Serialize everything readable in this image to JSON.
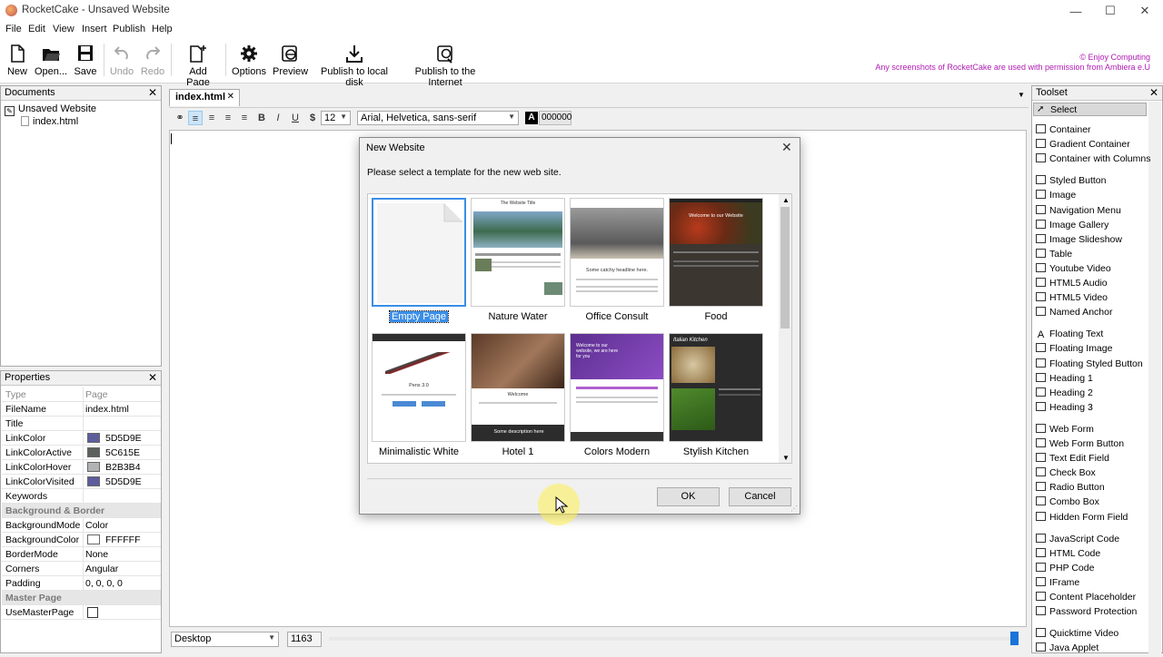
{
  "window": {
    "title": "RocketCake - Unsaved Website",
    "minimize": "—",
    "maximize": "☐",
    "close": "✕"
  },
  "menu": [
    "File",
    "Edit",
    "View",
    "Insert",
    "Publish",
    "Help"
  ],
  "toolbar": {
    "new": "New",
    "open": "Open...",
    "save": "Save",
    "undo": "Undo",
    "redo": "Redo",
    "add_page": "Add Page",
    "options": "Options",
    "preview": "Preview",
    "publish_local": "Publish to local disk",
    "publish_internet": "Publish to the Internet"
  },
  "copyright": {
    "line1": "© Enjoy Computing",
    "line2": "Any screenshots of RocketCake are used with permission from Ambiera e.U"
  },
  "documents": {
    "title": "Documents",
    "root": "Unsaved Website",
    "page": "index.html"
  },
  "properties": {
    "title": "Properties",
    "header": {
      "k": "Type",
      "v": "Page"
    },
    "rows": [
      {
        "k": "FileName",
        "v": "index.html"
      },
      {
        "k": "Title",
        "v": ""
      },
      {
        "k": "LinkColor",
        "v": "5D5D9E",
        "color": "#5D5D9E"
      },
      {
        "k": "LinkColorActive",
        "v": "5C615E",
        "color": "#5C615E"
      },
      {
        "k": "LinkColorHover",
        "v": "B2B3B4",
        "color": "#B2B3B4"
      },
      {
        "k": "LinkColorVisited",
        "v": "5D5D9E",
        "color": "#5D5D9E"
      },
      {
        "k": "Keywords",
        "v": ""
      }
    ],
    "group_bg": "Background & Border",
    "rows2": [
      {
        "k": "BackgroundMode",
        "v": "Color"
      },
      {
        "k": "BackgroundColor",
        "v": "FFFFFF",
        "color": "#FFFFFF"
      },
      {
        "k": "BorderMode",
        "v": "None"
      },
      {
        "k": "Corners",
        "v": "Angular"
      },
      {
        "k": "Padding",
        "v": "0, 0, 0, 0"
      }
    ],
    "group_master": "Master Page",
    "use_master": "UseMasterPage"
  },
  "editor": {
    "tab": "index.html",
    "font_size": "12",
    "font_family": "Arial, Helvetica, sans-serif",
    "text_color": "000000",
    "view": "Desktop",
    "width": "1163"
  },
  "toolset": {
    "title": "Toolset",
    "select": "Select",
    "items": [
      "Container",
      "Gradient Container",
      "Container with Columns",
      "Styled Button",
      "Image",
      "Navigation Menu",
      "Image Gallery",
      "Image Slideshow",
      "Table",
      "Youtube Video",
      "HTML5 Audio",
      "HTML5 Video",
      "Named Anchor",
      "Floating Text",
      "Floating Image",
      "Floating Styled Button",
      "Heading 1",
      "Heading 2",
      "Heading 3",
      "Web Form",
      "Web Form Button",
      "Text Edit Field",
      "Check Box",
      "Radio Button",
      "Combo Box",
      "Hidden Form Field",
      "JavaScript Code",
      "HTML Code",
      "PHP Code",
      "IFrame",
      "Content Placeholder",
      "Password Protection",
      "Quicktime Video",
      "Java Applet"
    ]
  },
  "dialog": {
    "title": "New Website",
    "prompt": "Please select a template for the new web site.",
    "templates": [
      "Empty Page",
      "Nature Water",
      "Office Consult",
      "Food",
      "Minimalistic White",
      "Hotel 1",
      "Colors Modern",
      "Stylish Kitchen"
    ],
    "selected": "Empty Page",
    "ok": "OK",
    "cancel": "Cancel",
    "thumb_text": {
      "nature_title": "The Website Title",
      "office_headline": "Some catchy headline here.",
      "food_welcome": "Welcome to our Website",
      "minimal_title": "Pens 3.0",
      "hotel_welcome": "Welcome",
      "hotel_desc": "Some description here",
      "colors_welcome": "Welcome to our website, we are here for you",
      "kitchen_title": "Italian Kitchen"
    }
  }
}
